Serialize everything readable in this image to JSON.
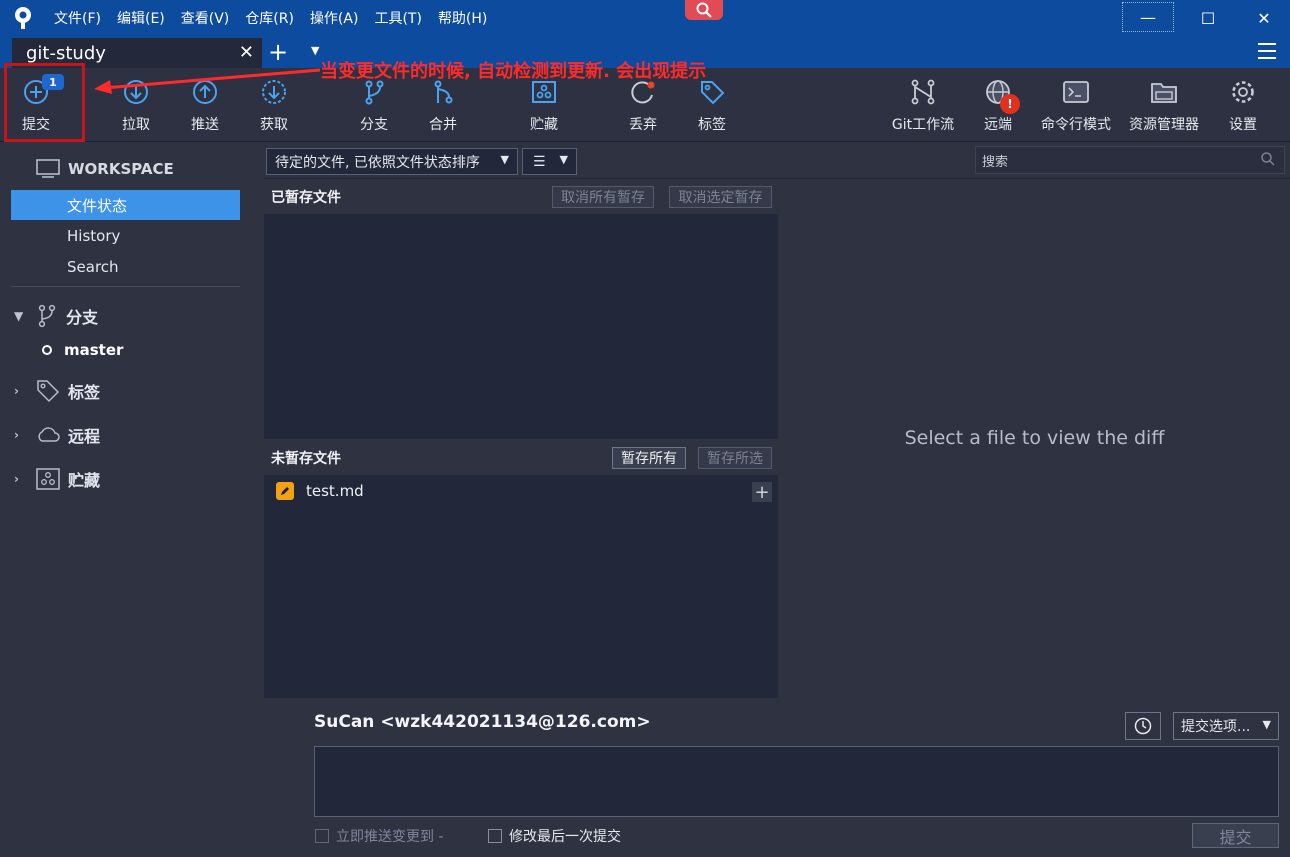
{
  "menu": [
    "文件(F)",
    "编辑(E)",
    "查看(V)",
    "仓库(R)",
    "操作(A)",
    "工具(T)",
    "帮助(H)"
  ],
  "window": {
    "min": "—",
    "max": "☐",
    "close": "✕"
  },
  "tab": {
    "name": "git-study",
    "close": "✕",
    "add": "+",
    "drop": "▼"
  },
  "toolbar": {
    "commit": "提交",
    "commit_badge": "1",
    "pull": "拉取",
    "push": "推送",
    "fetch": "获取",
    "branch": "分支",
    "merge": "合并",
    "stash": "贮藏",
    "discard": "丢弃",
    "tag": "标签",
    "gitflow": "Git工作流",
    "remote": "远端",
    "remote_alert": "!",
    "terminal": "命令行模式",
    "explorer": "资源管理器",
    "settings": "设置"
  },
  "annotation": "当变更文件的时候, 自动检测到更新. 会出现提示",
  "sidebar": {
    "workspace": "WORKSPACE",
    "items": [
      "文件状态",
      "History",
      "Search"
    ],
    "branches": "分支",
    "current_branch": "master",
    "tags": "标签",
    "remotes": "远程",
    "stashes": "贮藏"
  },
  "filter": {
    "sort": "待定的文件, 已依照文件状态排序",
    "view": "☰",
    "search_placeholder": "搜索"
  },
  "staged": {
    "title": "已暂存文件",
    "unstage_all": "取消所有暂存",
    "unstage_selected": "取消选定暂存"
  },
  "unstaged": {
    "title": "未暂存文件",
    "stage_all": "暂存所有",
    "stage_selected": "暂存所选",
    "files": [
      "test.md"
    ]
  },
  "diff": {
    "empty": "Select a file to view the diff"
  },
  "commit": {
    "author": "SuCan <wzk442021134@126.com>",
    "options": "提交选项...",
    "message": "",
    "push_now": "立即推送变更到 -",
    "amend": "修改最后一次提交",
    "submit": "提交"
  }
}
